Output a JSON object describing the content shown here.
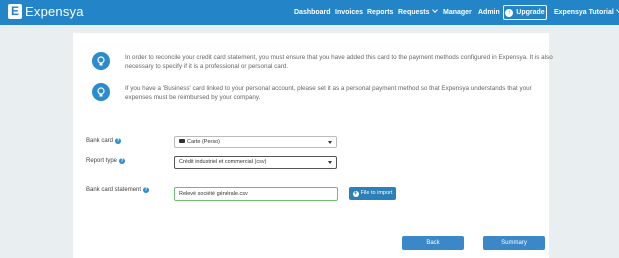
{
  "navbar": {
    "logo_letter": "E",
    "logo_text": "Expensya",
    "items": [
      {
        "label": "Dashboard"
      },
      {
        "label": "Invoices"
      },
      {
        "label": "Reports"
      },
      {
        "label": "Requests"
      },
      {
        "label": "Manager"
      },
      {
        "label": "Admin"
      }
    ],
    "upgrade_label": "Upgrade",
    "account_label": "Expensya Tutorial",
    "color": "#2385c7"
  },
  "info": [
    {
      "text": "In order to reconcile your credit card statement, you must ensure that you have added this card to the payment methods configured in Expensya. It is also necessary to specify if it is a professional or personal card.",
      "icon": "lightbulb-icon"
    },
    {
      "text": "If you have a 'Business' card linked to your personal account, please set it as a personal payment method so that Expensya understands that your expenses must be reimbursed by your company.",
      "icon": "lightbulb-icon"
    }
  ],
  "form": {
    "bank_card": {
      "label": "Bank card",
      "value": "Carte (Perso)"
    },
    "report_type": {
      "label": "Report type",
      "value": "Crédit industriel et commercial (csv)"
    },
    "statement": {
      "label": "Bank card statement",
      "value": "Relevé société générale.csv",
      "button": "File to import"
    }
  },
  "buttons": {
    "back": "Back",
    "summary": "Summary"
  }
}
